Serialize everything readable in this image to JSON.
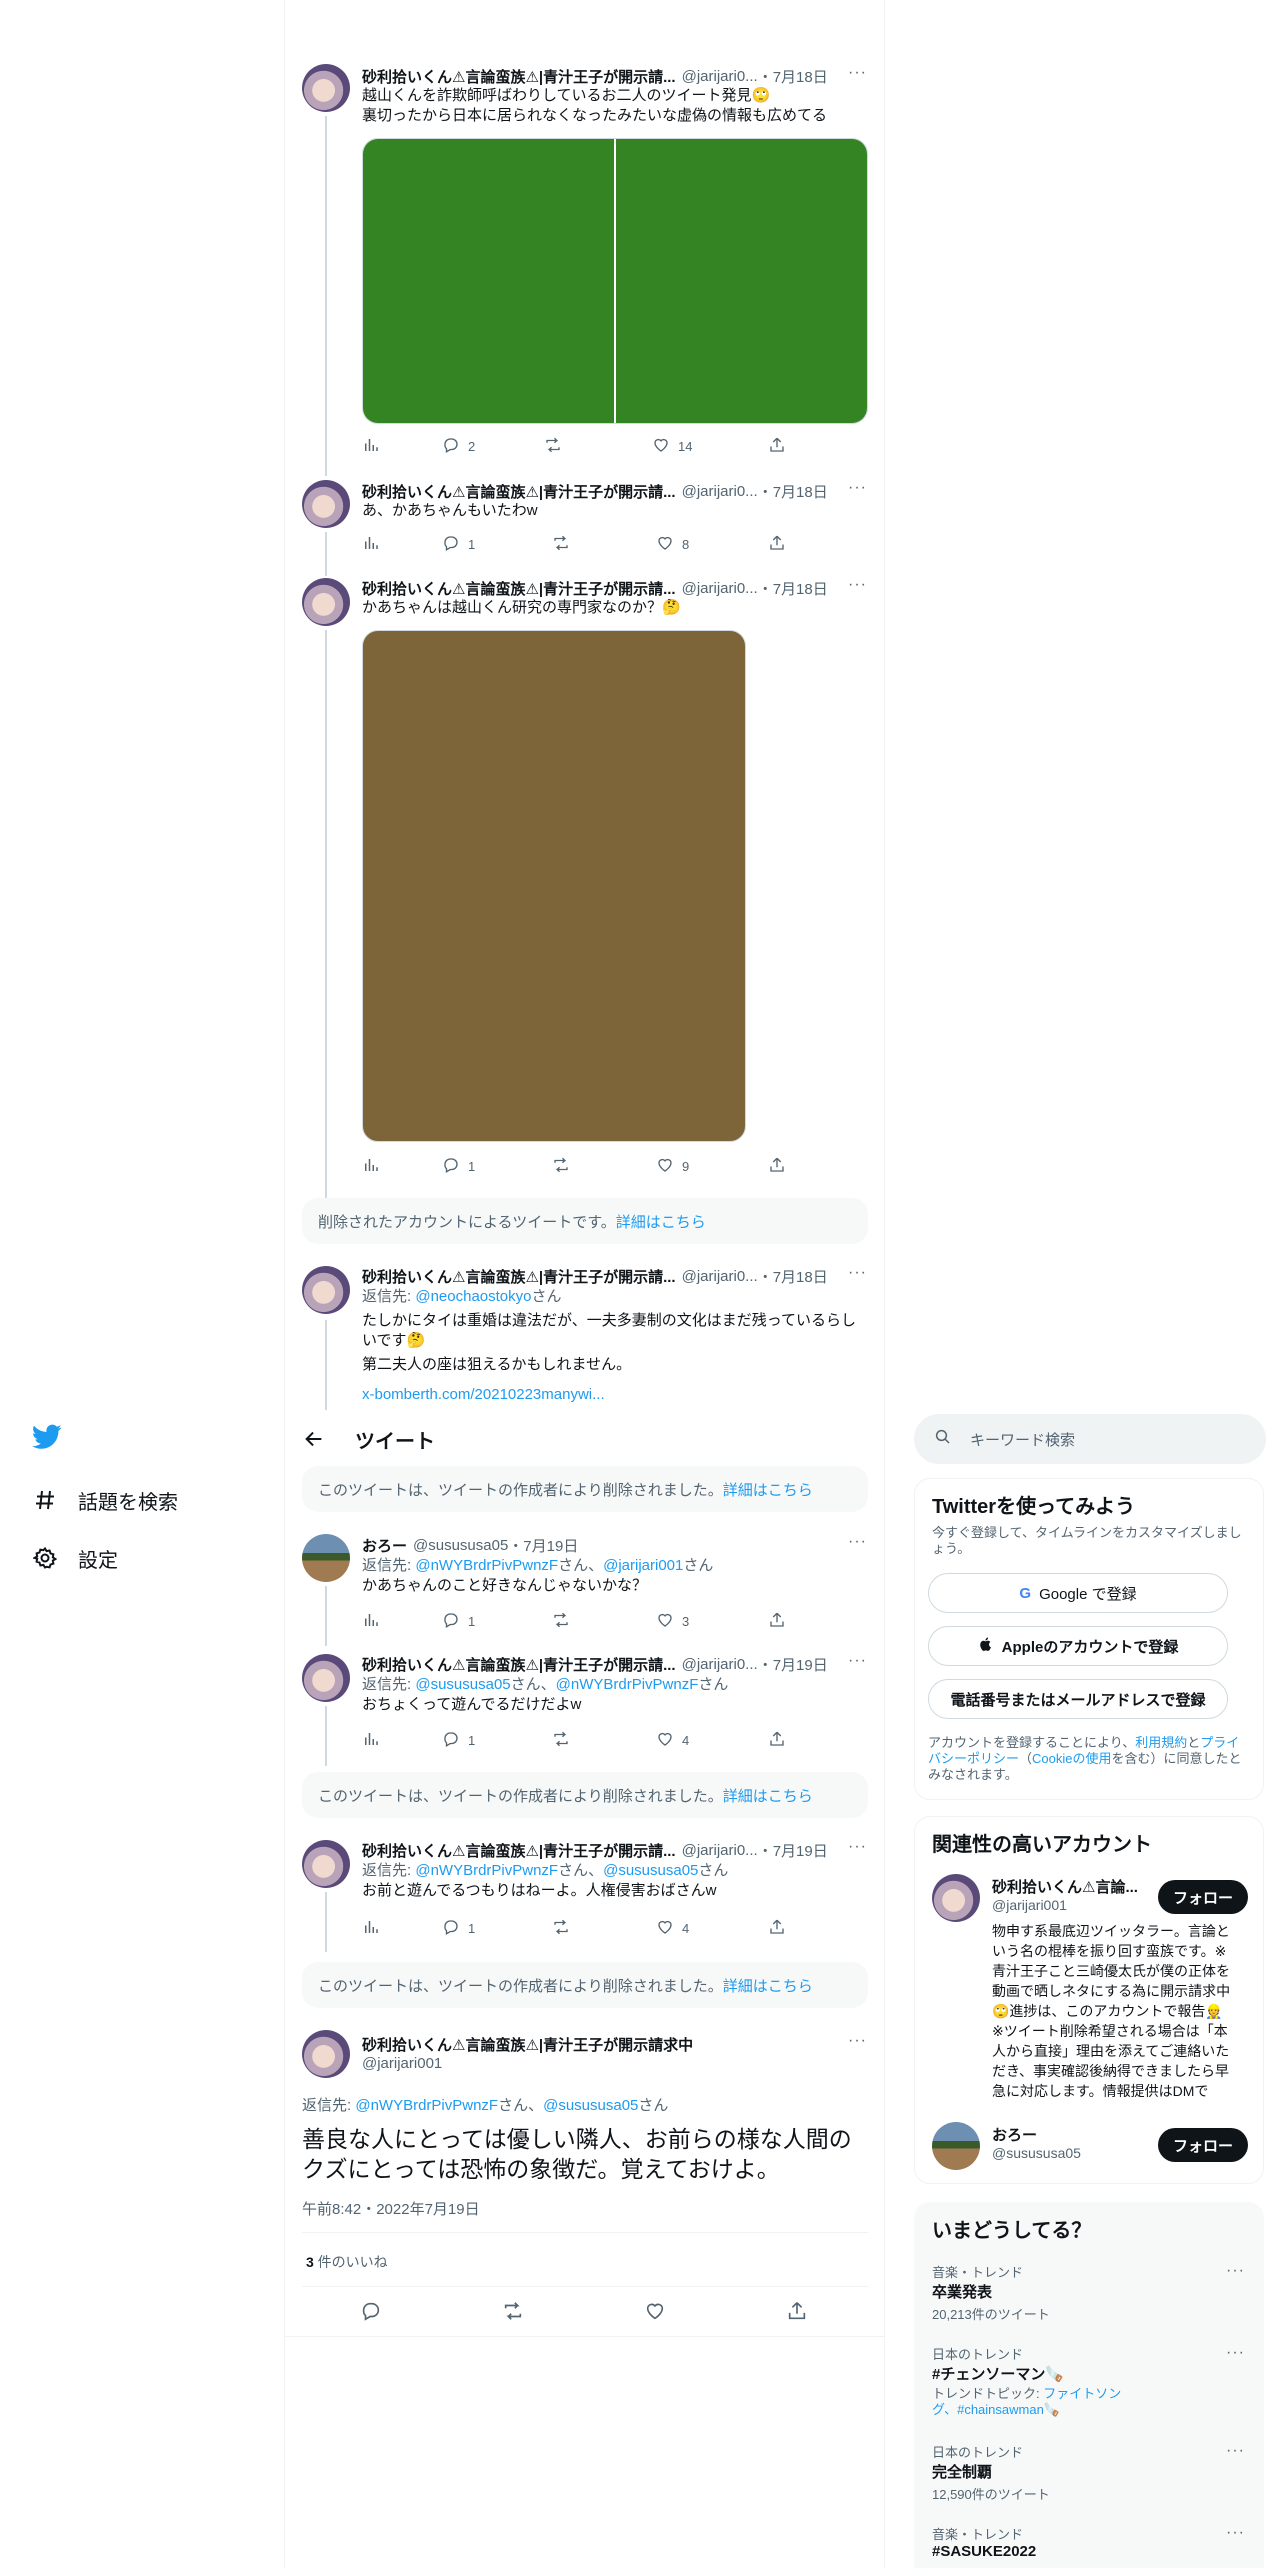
{
  "nav": {
    "logo": "twitter-bird-icon",
    "items": [
      {
        "label": "話題を検索",
        "icon": "hashtag-icon"
      },
      {
        "label": "設定",
        "icon": "gear-icon"
      }
    ]
  },
  "colors": {
    "accent": "#1d9bf0",
    "text": "#0f1419",
    "muted": "#536471",
    "media1": "#348424",
    "media2": "#7e6539"
  },
  "header": {
    "title": "ツイート",
    "back_icon": "arrow-left-icon"
  },
  "top_tweets": [
    {
      "name": "砂利拾いくん⚠言論蛮族⚠|青汁王子が開示請...",
      "handle": "@jarijari0...",
      "date": "・7月18日",
      "lines": [
        "越山くんを詐欺師呼ばわりしているお二人のツイート発見🙄",
        "裏切ったから日本に居られなくなったみたいな虚偽の情報も広めてる"
      ],
      "stats": {
        "replies": "2",
        "retweets": "",
        "likes": "14"
      }
    },
    {
      "name": "砂利拾いくん⚠言論蛮族⚠|青汁王子が開示請...",
      "handle": "@jarijari0...",
      "date": "・7月18日",
      "lines": [
        "あ、かあちゃんもいたわw"
      ],
      "stats": {
        "replies": "1",
        "retweets": "",
        "likes": "8"
      }
    },
    {
      "name": "砂利拾いくん⚠言論蛮族⚠|青汁王子が開示請...",
      "handle": "@jarijari0...",
      "date": "・7月18日",
      "lines": [
        "かあちゃんは越山くん研究の専門家なのか？🤔"
      ],
      "stats": {
        "replies": "1",
        "retweets": "",
        "likes": "9"
      }
    }
  ],
  "deleted_account_notice": {
    "text": "削除されたアカウントによるツイートです。",
    "link": "詳細はこちら"
  },
  "tweet4": {
    "name": "砂利拾いくん⚠言論蛮族⚠|青汁王子が開示請...",
    "handle": "@jarijari0...",
    "date": "・7月18日",
    "reply_prefix": "返信先: ",
    "reply_to": "@neochaostokyo",
    "reply_suffix": "さん",
    "lines": [
      "たしかにタイは重婚は違法だが、一夫多妻制の文化はまだ残っているらし",
      "いです🤔",
      "第二夫人の座は狙えるかもしれません。"
    ],
    "url": "x-bomberth.com/20210223manywi..."
  },
  "deleted_notice": {
    "text": "このツイートは、ツイートの作成者により削除されました。",
    "link": "詳細はこちら"
  },
  "reply_tweets": [
    {
      "name": "おろー",
      "handle": "@susususa05",
      "date": "・7月19日",
      "reply_prefix": "返信先: ",
      "reply_a": "@nWYBrdrPivPwnzF",
      "reply_mid": "さん、",
      "reply_b": "@jarijari001",
      "reply_suffix": "さん",
      "text": "かあちゃんのこと好きなんじゃないかな？",
      "stats": {
        "replies": "1",
        "retweets": "",
        "likes": "3"
      }
    },
    {
      "name": "砂利拾いくん⚠言論蛮族⚠|青汁王子が開示請...",
      "handle": "@jarijari0...",
      "date": "・7月19日",
      "reply_prefix": "返信先: ",
      "reply_a": "@susususa05",
      "reply_mid": "さん、",
      "reply_b": "@nWYBrdrPivPwnzF",
      "reply_suffix": "さん",
      "text": "おちょくって遊んでるだけだよw",
      "stats": {
        "replies": "1",
        "retweets": "",
        "likes": "4"
      }
    },
    {
      "name": "砂利拾いくん⚠言論蛮族⚠|青汁王子が開示請...",
      "handle": "@jarijari0...",
      "date": "・7月19日",
      "reply_prefix": "返信先: ",
      "reply_a": "@nWYBrdrPivPwnzF",
      "reply_mid": "さん、",
      "reply_b": "@susususa05",
      "reply_suffix": "さん",
      "text": "お前と遊んでるつもりはねーよ。人権侵害おばさんw",
      "stats": {
        "replies": "1",
        "retweets": "",
        "likes": "4"
      }
    }
  ],
  "main_tweet": {
    "name": "砂利拾いくん⚠言論蛮族⚠|青汁王子が開示請求中",
    "handle": "@jarijari001",
    "reply_prefix": "返信先: ",
    "reply_a": "@nWYBrdrPivPwnzF",
    "reply_mid": "さん、",
    "reply_b": "@susususa05",
    "reply_suffix": "さん",
    "line1": "善良な人にとっては優しい隣人、お前らの様な人間の",
    "line2": "クズにとっては恐怖の象徴だ。覚えておけよ。",
    "timestamp": "午前8:42・2022年7月19日",
    "likes_count": "3",
    "likes_label": " 件のいいね"
  },
  "search": {
    "placeholder": "キーワード検索"
  },
  "signup": {
    "title": "Twitterを使ってみよう",
    "desc": "今すぐ登録して、タイムラインをカスタマイズしましょう。",
    "google": "Google で登録",
    "apple": "Appleのアカウントで登録",
    "phone": "電話番号またはメールアドレスで登録",
    "terms_1": "アカウントを登録することにより、",
    "terms_link1": "利用規約",
    "terms_2": "と",
    "terms_link2": "プライバシーポリシー",
    "terms_3": "（",
    "terms_link3": "Cookieの使用",
    "terms_4": "を含む）に同意したとみなされます。"
  },
  "relevant": {
    "title": "関連性の高いアカウント",
    "follow_label": "フォロー",
    "accounts": [
      {
        "name": "砂利拾いくん⚠言論...",
        "handle": "@jarijari001",
        "bio": [
          "物申す系最底辺ツイッタラー。言論と",
          "いう名の棍棒を振り回す蛮族です。※",
          "青汁王子こと三崎優太氏が僕の正体を",
          "動画で晒しネタにする為に開示請求中",
          "🙄進捗は、このアカウントで報告👷",
          "※ツイート削除希望される場合は「本",
          "人から直接」理由を添えてご連絡いた",
          "だき、事実確認後納得できましたら早",
          "急に対応します。情報提供はDMで"
        ]
      },
      {
        "name": "おろー",
        "handle": "@susususa05"
      }
    ]
  },
  "trends": {
    "title": "いまどうしてる？",
    "items": [
      {
        "category": "音楽・トレンド",
        "name": "卒業発表",
        "count": "20,213件のツイート"
      },
      {
        "category": "日本のトレンド",
        "name": "#チェンソーマン🪚",
        "topic_prefix": "トレンドトピック: ",
        "topic_link": "ファイトソン",
        "topic_link2": "グ、#chainsawman🪚"
      },
      {
        "category": "日本のトレンド",
        "name": "完全制覇",
        "count": "12,590件のツイート"
      },
      {
        "category": "音楽・トレンド",
        "name": "#SASUKE2022"
      }
    ]
  }
}
